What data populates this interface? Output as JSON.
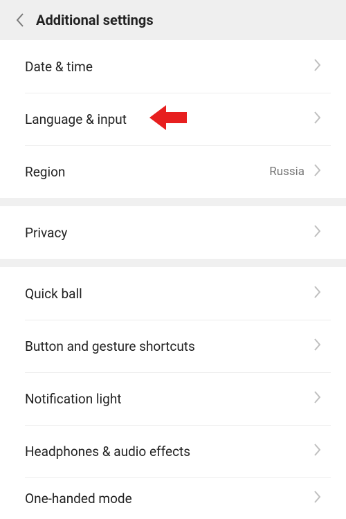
{
  "header": {
    "title": "Additional settings"
  },
  "groups": [
    {
      "items": [
        {
          "label": "Date & time",
          "value": "",
          "annotated": false
        },
        {
          "label": "Language & input",
          "value": "",
          "annotated": true
        },
        {
          "label": "Region",
          "value": "Russia",
          "annotated": false
        }
      ]
    },
    {
      "items": [
        {
          "label": "Privacy",
          "value": "",
          "annotated": false
        }
      ]
    },
    {
      "items": [
        {
          "label": "Quick ball",
          "value": "",
          "annotated": false
        },
        {
          "label": "Button and gesture shortcuts",
          "value": "",
          "annotated": false
        },
        {
          "label": "Notification light",
          "value": "",
          "annotated": false
        },
        {
          "label": "Headphones & audio effects",
          "value": "",
          "annotated": false
        },
        {
          "label": "One-handed mode",
          "value": "",
          "annotated": false
        }
      ]
    }
  ],
  "annotation_color": "#e71f1f"
}
